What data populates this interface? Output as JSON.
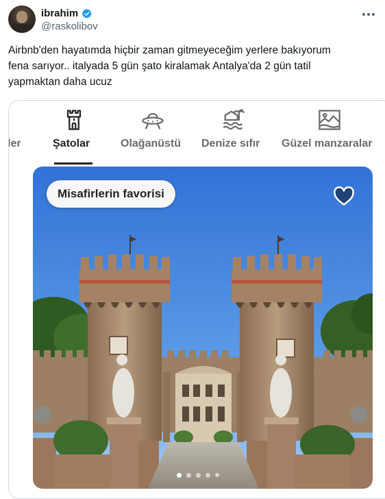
{
  "author": {
    "name": "ibrahim",
    "handle": "@raskolibov",
    "verified": true,
    "avatar_icon": "profile-photo"
  },
  "tweet": {
    "text_lines": [
      "Airbnb'den hayatımda hiçbir zaman gitmeyeceğim yerlere bakıyorum",
      "fena sarıyor.. italyada 5 gün şato kiralamak Antalya'da 2 gün tatil",
      "yapmaktan daha ucuz"
    ]
  },
  "airbnb": {
    "categories": [
      {
        "label": "ler",
        "icon": "partial-category-icon",
        "active": false
      },
      {
        "label": "Şatolar",
        "icon": "castle-icon",
        "active": true
      },
      {
        "label": "Olağanüstü",
        "icon": "ufo-icon",
        "active": false
      },
      {
        "label": "Denize sıfır",
        "icon": "beachfront-icon",
        "active": false
      },
      {
        "label": "Güzel manzaralar",
        "icon": "amazing-views-icon",
        "active": false
      }
    ],
    "listing": {
      "badge": "Misafirlerin favorisi",
      "favorite_icon": "heart-icon",
      "photo_count": 5,
      "active_photo": 1
    }
  },
  "colors": {
    "text": "#0f1419",
    "muted": "#536471",
    "verified_blue": "#1d9bf0",
    "airbnb_dark": "#222222",
    "airbnb_muted": "#6a6a6a",
    "sky": "#3f87dd"
  }
}
